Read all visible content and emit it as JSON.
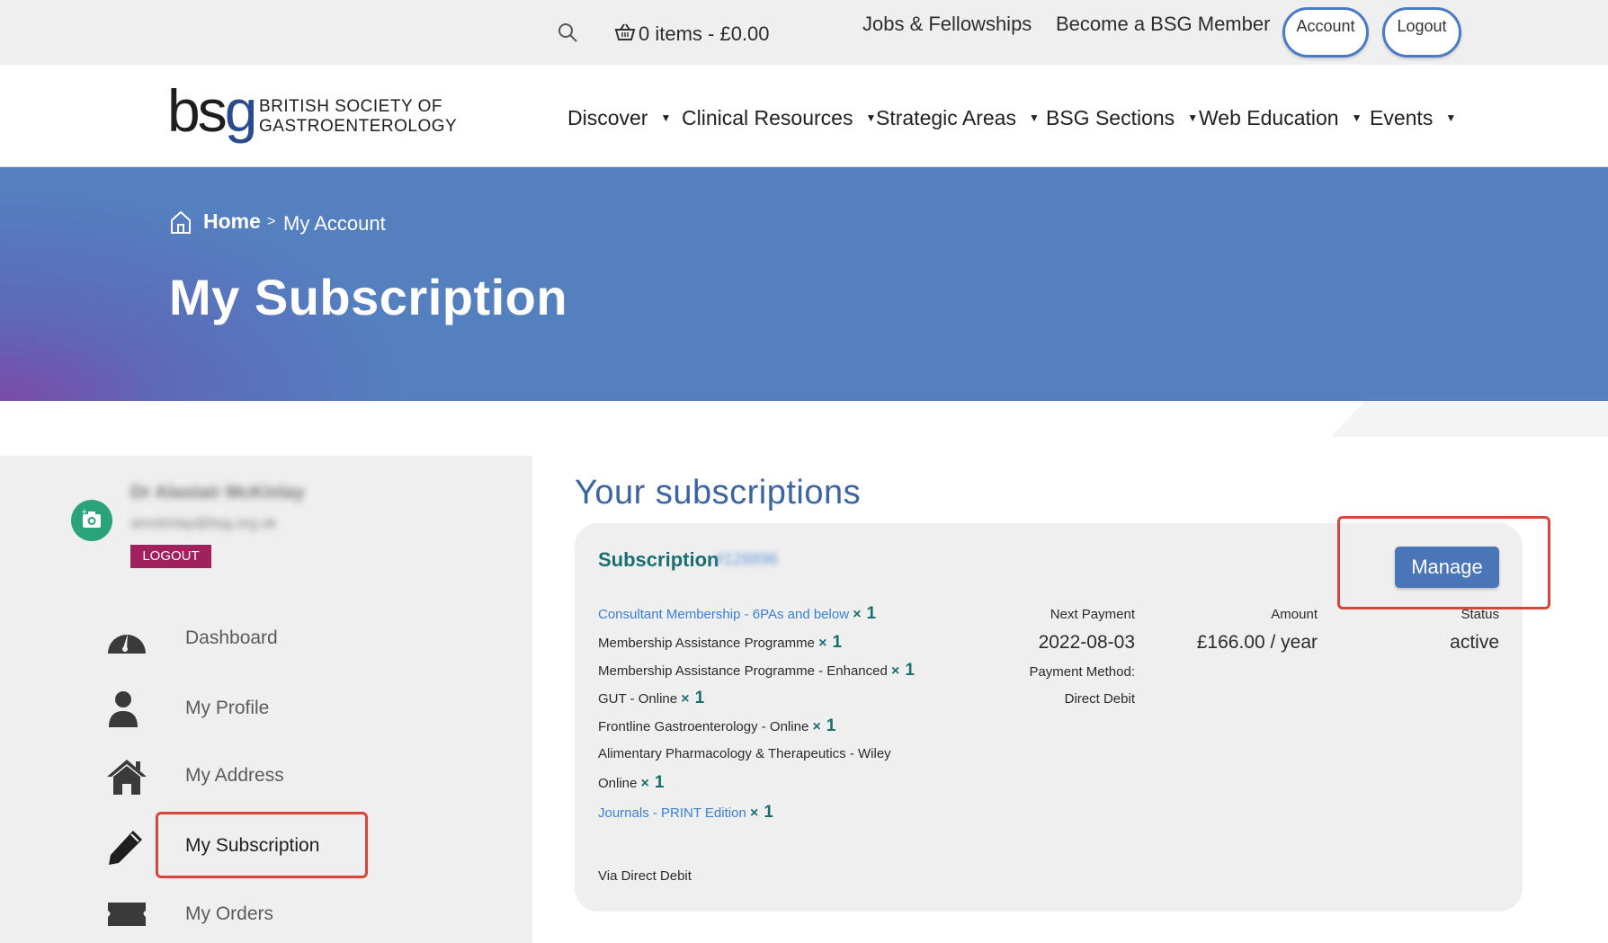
{
  "topbar": {
    "cart_label": "0 items - £0.00",
    "links": [
      "Jobs & Fellowships",
      "Become a BSG Member"
    ],
    "account_label": "Account",
    "logout_label": "Logout"
  },
  "header": {
    "logo_mark": "bsg",
    "logo_line1": "BRITISH SOCIETY OF",
    "logo_line2": "GASTROENTEROLOGY",
    "nav": [
      "Discover",
      "Clinical Resources",
      "Strategic Areas",
      "BSG Sections",
      "Web Education",
      "Events"
    ]
  },
  "hero": {
    "breadcrumb_home": "Home",
    "breadcrumb_sep": ">",
    "breadcrumb_current": "My Account",
    "title": "My Subscription"
  },
  "sidebar": {
    "user_name": "Dr Alastair McKinlay",
    "user_email": "amckinlay@bsg.org.uk",
    "logout_label": "LOGOUT",
    "items": [
      {
        "label": "Dashboard",
        "icon": "dashboard-icon"
      },
      {
        "label": "My Profile",
        "icon": "user-icon"
      },
      {
        "label": "My Address",
        "icon": "home-icon"
      },
      {
        "label": "My Subscription",
        "icon": "pencil-icon"
      },
      {
        "label": "My Orders",
        "icon": "ticket-icon"
      }
    ]
  },
  "main": {
    "title": "Your subscriptions",
    "subscription_label": "Subscription",
    "subscription_id": "#128896",
    "manage_label": "Manage",
    "items": [
      {
        "name": "Consultant Membership - 6PAs and below",
        "qty": "1"
      },
      {
        "name": "Membership Assistance Programme",
        "qty": "1"
      },
      {
        "name": "Membership Assistance Programme - Enhanced",
        "qty": "1"
      },
      {
        "name": "GUT - Online",
        "qty": "1"
      },
      {
        "name": "Frontline Gastroenterology - Online",
        "qty": "1"
      },
      {
        "name": "Alimentary Pharmacology & Therapeutics - Wiley",
        "qty": ""
      },
      {
        "name": "Online",
        "qty": "1"
      },
      {
        "name": "Journals - PRINT Edition",
        "qty": "1"
      }
    ],
    "next_payment_label": "Next Payment",
    "next_payment_value": "2022-08-03",
    "payment_method_label": "Payment Method:",
    "payment_method_value": "Direct Debit",
    "amount_label": "Amount",
    "amount_value": "£166.00 / year",
    "status_label": "Status",
    "status_value": "active",
    "via": "Via Direct Debit"
  },
  "colors": {
    "hero_blue": "#5480c0",
    "accent_teal": "#1a6e72",
    "link_blue": "#3a7fd6",
    "highlight_red": "#d9453a",
    "logout_magenta": "#a0215e"
  }
}
